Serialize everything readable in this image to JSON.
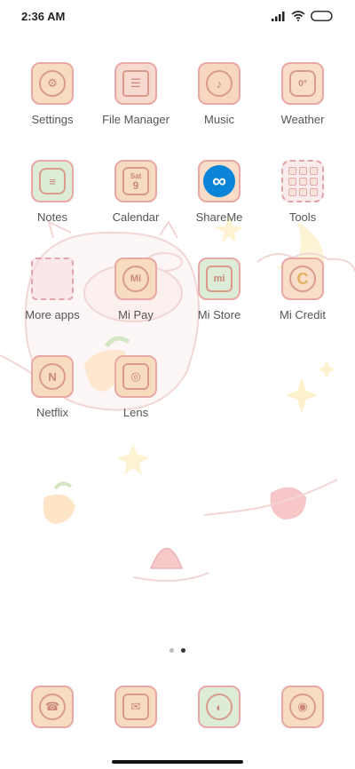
{
  "status_bar": {
    "time": "2:36 AM"
  },
  "home": {
    "apps": [
      {
        "label": "Settings",
        "glyph": "⚙",
        "bg": "#f8dcc0"
      },
      {
        "label": "File Manager",
        "glyph": "☰",
        "bg": "#f6d9cf"
      },
      {
        "label": "Music",
        "glyph": "♪",
        "bg": "#f8d7c0"
      },
      {
        "label": "Weather",
        "glyph": "0°",
        "bg": "#f8ddc9"
      },
      {
        "label": "Notes",
        "glyph": "≡",
        "bg": "#dcecd7"
      },
      {
        "label": "Calendar",
        "glyph": "9",
        "bg": "#f6dcc0"
      },
      {
        "label": "ShareMe",
        "glyph": "∞",
        "bg": "#f8ddc9"
      },
      {
        "label": "Tools",
        "glyph": "",
        "bg": ""
      },
      {
        "label": "More apps",
        "glyph": "",
        "bg": ""
      },
      {
        "label": "Mi Pay",
        "glyph": "Mi",
        "bg": "#f8dcc0"
      },
      {
        "label": "Mi Store",
        "glyph": "mi",
        "bg": "#dcecd7"
      },
      {
        "label": "Mi Credit",
        "glyph": "C",
        "bg": "#f8ddc9"
      },
      {
        "label": "Netflix",
        "glyph": "N",
        "bg": "#f8dcc0"
      },
      {
        "label": "Lens",
        "glyph": "◎",
        "bg": "#f8dcc0"
      }
    ],
    "calendar_day": "Sat",
    "page_indicator": {
      "pages": 2,
      "current": 2
    }
  },
  "dock": [
    {
      "name": "phone",
      "glyph": "☎",
      "bg": "#f8dcc0"
    },
    {
      "name": "messages",
      "glyph": "✉",
      "bg": "#f8dcc0"
    },
    {
      "name": "browser",
      "glyph": "◐",
      "bg": "#dcecd7"
    },
    {
      "name": "camera",
      "glyph": "◉",
      "bg": "#f8dcc0"
    }
  ],
  "colors": {
    "icon_border": "#e9a7a6",
    "shareme_blue": "#0a84d6"
  }
}
